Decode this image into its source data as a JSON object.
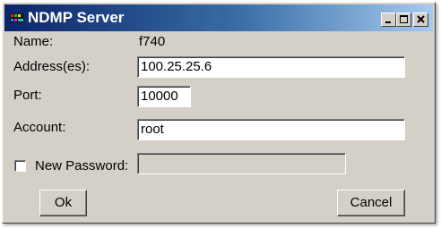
{
  "window": {
    "title": "NDMP Server",
    "controls": [
      "minimize-icon",
      "maximize-icon",
      "close-icon"
    ]
  },
  "form": {
    "name_label": "Name:",
    "name_value": "f740",
    "address_label": "Address(es):",
    "address_value": "100.25.25.6",
    "port_label": "Port:",
    "port_value": "10000",
    "account_label": "Account:",
    "account_value": "root",
    "new_password_label": "New Password:",
    "new_password_checked": false,
    "new_password_value": ""
  },
  "buttons": {
    "ok_label": "Ok",
    "cancel_label": "Cancel"
  },
  "colors": {
    "title_start": "#0a246a",
    "title_end": "#a6caf0",
    "face": "#d4d0c8"
  }
}
